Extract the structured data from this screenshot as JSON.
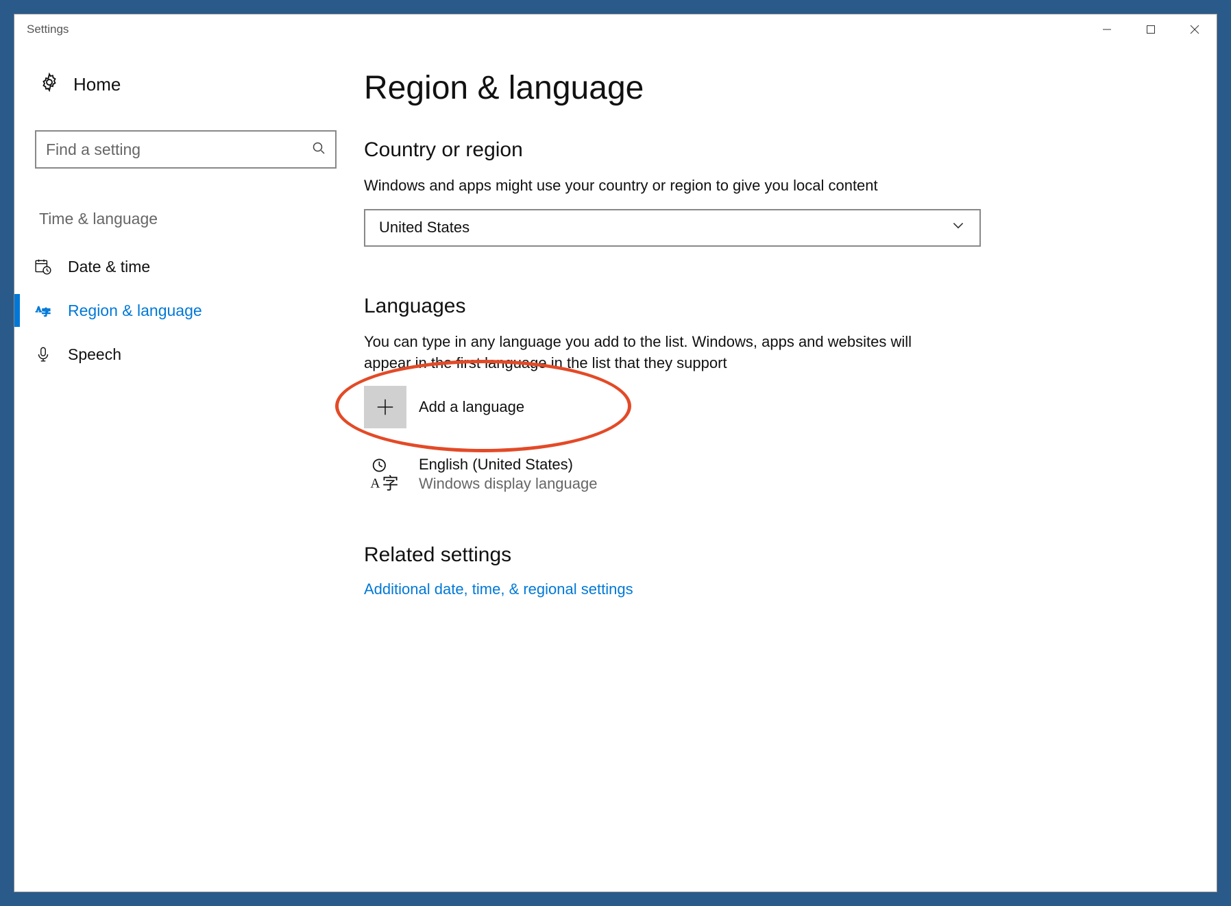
{
  "window": {
    "title": "Settings"
  },
  "sidebar": {
    "home_label": "Home",
    "search_placeholder": "Find a setting",
    "category": "Time & language",
    "items": [
      {
        "label": "Date & time"
      },
      {
        "label": "Region & language"
      },
      {
        "label": "Speech"
      }
    ]
  },
  "main": {
    "title": "Region & language",
    "country_section_title": "Country or region",
    "country_desc": "Windows and apps might use your country or region to give you local content",
    "country_value": "United States",
    "languages_section_title": "Languages",
    "languages_desc": "You can type in any language you add to the list. Windows, apps and websites will appear in the first language in the list that they support",
    "add_language_label": "Add a language",
    "installed_language": {
      "name": "English (United States)",
      "subtitle": "Windows display language"
    },
    "related_title": "Related settings",
    "related_link": "Additional date, time, & regional settings"
  }
}
